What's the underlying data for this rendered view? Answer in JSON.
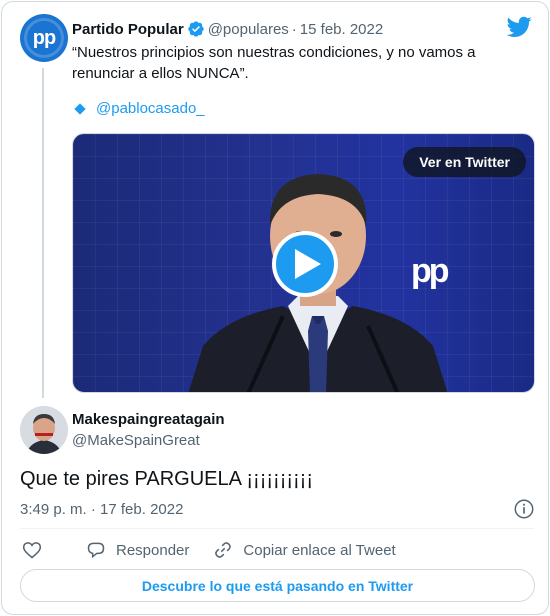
{
  "tweet": {
    "author_name": "Partido Popular",
    "author_handle": "@populares",
    "separator": "·",
    "date": "15 feb. 2022",
    "text": "“Nuestros principios son nuestras condiciones, y no vamos a renunciar a ellos NUNCA”.",
    "mention": "@pablocasado_",
    "video_button": "Ver en Twitter",
    "avatar_text": "pp",
    "video_logo_text": "pp"
  },
  "reply": {
    "author_name": "Makespaingreatagain",
    "author_handle": "@MakeSpainGreat",
    "text": "Que te pires PARGUELA ¡¡¡¡¡¡¡¡¡¡",
    "timestamp": "3:49 p. m. · 17 feb. 2022"
  },
  "actions": {
    "reply_label": "Responder",
    "copy_label": "Copiar enlace al Tweet"
  },
  "footer": {
    "discover_label": "Descubre lo que está pasando en Twitter"
  },
  "icons": {
    "verified": "verified-badge-icon",
    "twitter": "twitter-bird-icon",
    "play": "play-icon",
    "info": "info-icon",
    "like": "heart-icon",
    "reply": "comment-bubble-icon",
    "link": "link-icon"
  },
  "colors": {
    "accent": "#1d9bf0",
    "text_primary": "#0f1419",
    "text_secondary": "#536471",
    "border": "#cfd9de",
    "pp_blue": "#1a74d1"
  }
}
